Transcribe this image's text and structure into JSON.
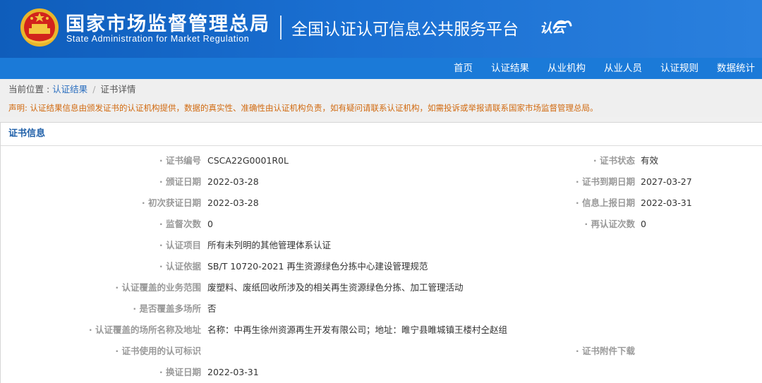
{
  "header": {
    "org_name_cn": "国家市场监督管理总局",
    "org_name_en": "State Administration  for  Market Regulation",
    "platform_name": "全国认证认可信息公共服务平台",
    "cloud_logo_text": "认云",
    "emblem_icon": "national-emblem-icon",
    "colors": {
      "header_blue": "#1565c0",
      "nav_blue": "#1b7ad8"
    }
  },
  "nav": {
    "items": [
      "首页",
      "认证结果",
      "从业机构",
      "从业人员",
      "认证规则",
      "数据统计"
    ]
  },
  "breadcrumb": {
    "prefix": "当前位置 : ",
    "link": "认证结果",
    "separator": "/",
    "current": "证书详情"
  },
  "notice": "声明: 认证结果信息由颁发证书的认证机构提供，数据的真实性、准确性由认证机构负责，如有疑问请联系认证机构，如需投诉或举报请联系国家市场监督管理总局。",
  "panel": {
    "title": "证书信息",
    "rows": [
      {
        "label": "证书编号",
        "value": "CSCA22G0001R0L",
        "label2": "证书状态",
        "value2": "有效"
      },
      {
        "label": "颁证日期",
        "value": "2022-03-28",
        "label2": "证书到期日期",
        "value2": "2027-03-27"
      },
      {
        "label": "初次获证日期",
        "value": "2022-03-28",
        "label2": "信息上报日期",
        "value2": "2022-03-31"
      },
      {
        "label": "监督次数",
        "value": "0",
        "label2": "再认证次数",
        "value2": "0"
      },
      {
        "label": "认证项目",
        "value": "所有未列明的其他管理体系认证"
      },
      {
        "label": "认证依据",
        "value": "SB/T 10720-2021 再生资源绿色分拣中心建设管理规范"
      },
      {
        "label": "认证覆盖的业务范围",
        "value": "废塑料、废纸回收所涉及的相关再生资源绿色分拣、加工管理活动"
      },
      {
        "label": "是否覆盖多场所",
        "value": "否"
      },
      {
        "label": "认证覆盖的场所名称及地址",
        "value": "名称：中再生徐州资源再生开发有限公司；地址：睢宁县睢城镇王楼村仝赵组"
      },
      {
        "label": "证书使用的认可标识",
        "value": "",
        "label2": "证书附件下载",
        "value2": ""
      },
      {
        "label": "换证日期",
        "value": "2022-03-31"
      }
    ]
  }
}
